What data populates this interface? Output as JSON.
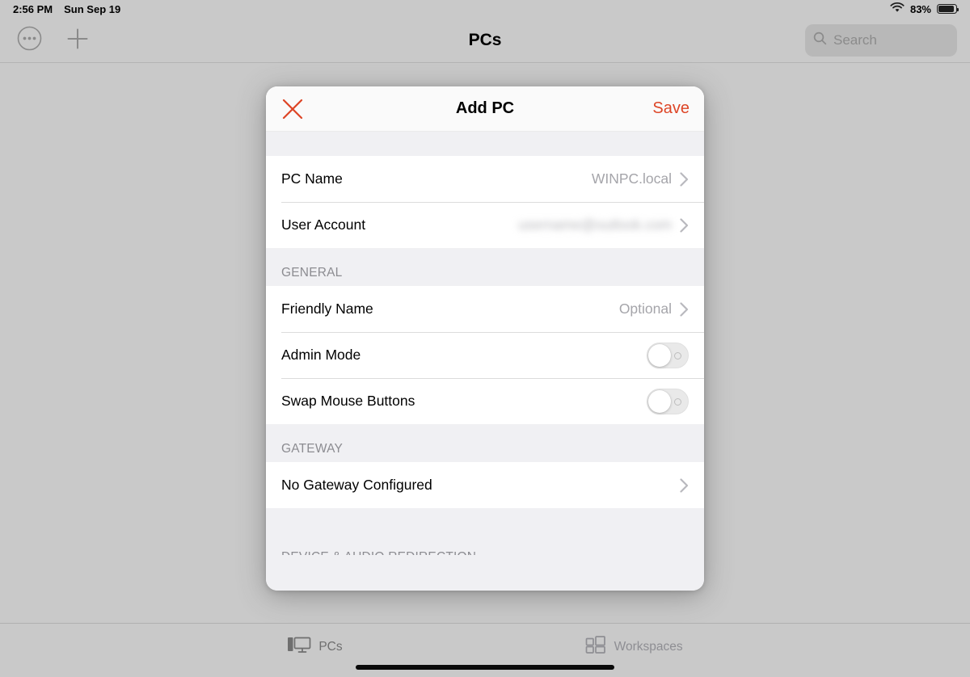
{
  "status_bar": {
    "time": "2:56 PM",
    "date": "Sun Sep 19",
    "battery_percent": "83%",
    "wifi_icon": "wifi-icon",
    "battery_icon": "battery-icon"
  },
  "navbar": {
    "title": "PCs",
    "more_icon": "more-circle-icon",
    "add_icon": "plus-icon",
    "search": {
      "placeholder": "Search",
      "icon": "search-icon"
    }
  },
  "modal": {
    "title": "Add PC",
    "close_icon": "close-icon",
    "save_label": "Save",
    "accent_color": "#dd4526",
    "sections": [
      {
        "header": "",
        "rows": [
          {
            "label": "PC Name",
            "value": "WINPC.local",
            "type": "disclosure",
            "redacted": false
          },
          {
            "label": "User Account",
            "value": "username@outlook.com",
            "type": "disclosure",
            "redacted": true
          }
        ]
      },
      {
        "header": "GENERAL",
        "rows": [
          {
            "label": "Friendly Name",
            "value": "Optional",
            "type": "disclosure",
            "redacted": false
          },
          {
            "label": "Admin Mode",
            "value": "",
            "type": "toggle",
            "toggle_on": false
          },
          {
            "label": "Swap Mouse Buttons",
            "value": "",
            "type": "toggle",
            "toggle_on": false
          }
        ]
      },
      {
        "header": "GATEWAY",
        "rows": [
          {
            "label": "No Gateway Configured",
            "value": "",
            "type": "disclosure",
            "redacted": false
          }
        ]
      }
    ],
    "clipped_section_header": "DEVICE & AUDIO REDIRECTION"
  },
  "tabbar": {
    "tabs": [
      {
        "label": "PCs",
        "icon": "desktop-computer-icon",
        "selected": true
      },
      {
        "label": "Workspaces",
        "icon": "workspaces-grid-icon",
        "selected": false
      }
    ]
  }
}
